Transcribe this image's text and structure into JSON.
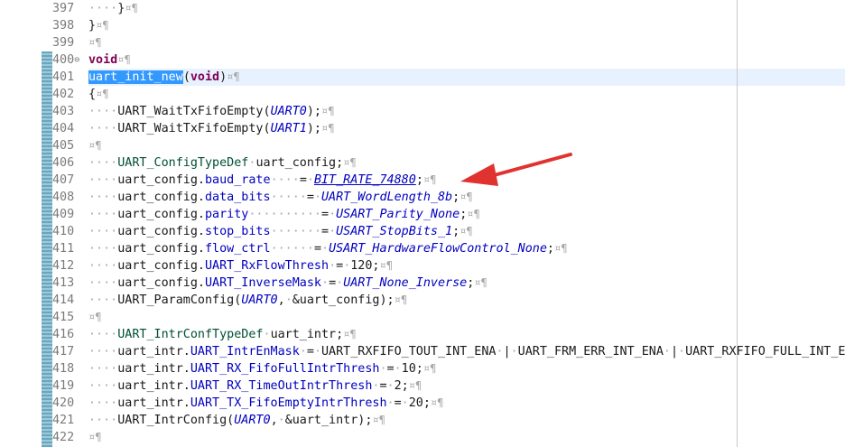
{
  "colors": {
    "keyword": "#7f0055",
    "type": "#005032",
    "constant": "#0000c0",
    "selection": "#3399ff",
    "current_line": "#e8f2fe",
    "annotation_arrow": "#e0332f"
  },
  "lines": [
    {
      "no": "397",
      "parts": [
        [
          "ws",
          "····"
        ],
        [
          "p",
          "}"
        ],
        [
          "pil",
          "¤¶"
        ]
      ]
    },
    {
      "no": "398",
      "parts": [
        [
          "p",
          "}"
        ],
        [
          "pil",
          "¤¶"
        ]
      ]
    },
    {
      "no": "399",
      "parts": [
        [
          "pil",
          "¤¶"
        ]
      ]
    },
    {
      "no": "400",
      "fold": true,
      "parts": [
        [
          "k",
          "void"
        ],
        [
          "pil",
          "¤¶"
        ]
      ]
    },
    {
      "no": "401",
      "current": true,
      "parts": [
        [
          "sel",
          "uart_init_new"
        ],
        [
          "p",
          "("
        ],
        [
          "k",
          "void"
        ],
        [
          "p",
          ")"
        ],
        [
          "pil",
          "¤¶"
        ]
      ]
    },
    {
      "no": "402",
      "parts": [
        [
          "p",
          "{"
        ],
        [
          "pil",
          "¤¶"
        ]
      ]
    },
    {
      "no": "403",
      "parts": [
        [
          "ws",
          "····"
        ],
        [
          "f",
          "UART_WaitTxFifoEmpty("
        ],
        [
          "c",
          "UART0"
        ],
        [
          "p",
          ");"
        ],
        [
          "pil",
          "¤¶"
        ]
      ]
    },
    {
      "no": "404",
      "parts": [
        [
          "ws",
          "····"
        ],
        [
          "f",
          "UART_WaitTxFifoEmpty("
        ],
        [
          "c",
          "UART1"
        ],
        [
          "p",
          ");"
        ],
        [
          "pil",
          "¤¶"
        ]
      ]
    },
    {
      "no": "405",
      "parts": [
        [
          "pil",
          "¤¶"
        ]
      ]
    },
    {
      "no": "406",
      "parts": [
        [
          "ws",
          "····"
        ],
        [
          "t",
          "UART_ConfigTypeDef"
        ],
        [
          "ws",
          "·"
        ],
        [
          "p",
          "uart_config;"
        ],
        [
          "pil",
          "¤¶"
        ]
      ]
    },
    {
      "no": "407",
      "parts": [
        [
          "ws",
          "····"
        ],
        [
          "p",
          "uart_config."
        ],
        [
          "m",
          "baud_rate"
        ],
        [
          "ws",
          "····"
        ],
        [
          "p",
          "="
        ],
        [
          "ws",
          "·"
        ],
        [
          "cu",
          "BIT_RATE_74880"
        ],
        [
          "p",
          ";"
        ],
        [
          "pil",
          "¤¶"
        ]
      ]
    },
    {
      "no": "408",
      "parts": [
        [
          "ws",
          "····"
        ],
        [
          "p",
          "uart_config."
        ],
        [
          "m",
          "data_bits"
        ],
        [
          "ws",
          "·····"
        ],
        [
          "p",
          "="
        ],
        [
          "ws",
          "·"
        ],
        [
          "c",
          "UART_WordLength_8b"
        ],
        [
          "p",
          ";"
        ],
        [
          "pil",
          "¤¶"
        ]
      ]
    },
    {
      "no": "409",
      "parts": [
        [
          "ws",
          "····"
        ],
        [
          "p",
          "uart_config."
        ],
        [
          "m",
          "parity"
        ],
        [
          "ws",
          "··········"
        ],
        [
          "p",
          "="
        ],
        [
          "ws",
          "·"
        ],
        [
          "c",
          "USART_Parity_None"
        ],
        [
          "p",
          ";"
        ],
        [
          "pil",
          "¤¶"
        ]
      ]
    },
    {
      "no": "410",
      "parts": [
        [
          "ws",
          "····"
        ],
        [
          "p",
          "uart_config."
        ],
        [
          "m",
          "stop_bits"
        ],
        [
          "ws",
          "·······"
        ],
        [
          "p",
          "="
        ],
        [
          "ws",
          "·"
        ],
        [
          "c",
          "USART_StopBits_1"
        ],
        [
          "p",
          ";"
        ],
        [
          "pil",
          "¤¶"
        ]
      ]
    },
    {
      "no": "411",
      "parts": [
        [
          "ws",
          "····"
        ],
        [
          "p",
          "uart_config."
        ],
        [
          "m",
          "flow_ctrl"
        ],
        [
          "ws",
          "······"
        ],
        [
          "p",
          "="
        ],
        [
          "ws",
          "·"
        ],
        [
          "c",
          "USART_HardwareFlowControl_None"
        ],
        [
          "p",
          ";"
        ],
        [
          "pil",
          "¤¶"
        ]
      ]
    },
    {
      "no": "412",
      "parts": [
        [
          "ws",
          "····"
        ],
        [
          "p",
          "uart_config."
        ],
        [
          "m",
          "UART_RxFlowThresh"
        ],
        [
          "ws",
          "·"
        ],
        [
          "p",
          "="
        ],
        [
          "ws",
          "·"
        ],
        [
          "p",
          "120;"
        ],
        [
          "pil",
          "¤¶"
        ]
      ]
    },
    {
      "no": "413",
      "parts": [
        [
          "ws",
          "····"
        ],
        [
          "p",
          "uart_config."
        ],
        [
          "m",
          "UART_InverseMask"
        ],
        [
          "ws",
          "·"
        ],
        [
          "p",
          "="
        ],
        [
          "ws",
          "·"
        ],
        [
          "c",
          "UART_None_Inverse"
        ],
        [
          "p",
          ";"
        ],
        [
          "pil",
          "¤¶"
        ]
      ]
    },
    {
      "no": "414",
      "parts": [
        [
          "ws",
          "····"
        ],
        [
          "f",
          "UART_ParamConfig("
        ],
        [
          "c",
          "UART0"
        ],
        [
          "p",
          ","
        ],
        [
          "ws",
          "·"
        ],
        [
          "p",
          "&uart_config);"
        ],
        [
          "pil",
          "¤¶"
        ]
      ]
    },
    {
      "no": "415",
      "parts": [
        [
          "pil",
          "¤¶"
        ]
      ]
    },
    {
      "no": "416",
      "parts": [
        [
          "ws",
          "····"
        ],
        [
          "t",
          "UART_IntrConfTypeDef"
        ],
        [
          "ws",
          "·"
        ],
        [
          "p",
          "uart_intr;"
        ],
        [
          "pil",
          "¤¶"
        ]
      ]
    },
    {
      "no": "417",
      "parts": [
        [
          "ws",
          "····"
        ],
        [
          "p",
          "uart_intr."
        ],
        [
          "m",
          "UART_IntrEnMask"
        ],
        [
          "ws",
          "·"
        ],
        [
          "p",
          "="
        ],
        [
          "ws",
          "·"
        ],
        [
          "p",
          "UART_RXFIFO_TOUT_INT_ENA"
        ],
        [
          "ws",
          "·"
        ],
        [
          "p",
          "|"
        ],
        [
          "ws",
          "·"
        ],
        [
          "p",
          "UART_FRM_ERR_INT_ENA"
        ],
        [
          "ws",
          "·"
        ],
        [
          "p",
          "|"
        ],
        [
          "ws",
          "·"
        ],
        [
          "p",
          "UART_RXFIFO_FULL_INT_ENA"
        ]
      ]
    },
    {
      "no": "418",
      "parts": [
        [
          "ws",
          "····"
        ],
        [
          "p",
          "uart_intr."
        ],
        [
          "m",
          "UART_RX_FifoFullIntrThresh"
        ],
        [
          "ws",
          "·"
        ],
        [
          "p",
          "="
        ],
        [
          "ws",
          "·"
        ],
        [
          "p",
          "10;"
        ],
        [
          "pil",
          "¤¶"
        ]
      ]
    },
    {
      "no": "419",
      "parts": [
        [
          "ws",
          "····"
        ],
        [
          "p",
          "uart_intr."
        ],
        [
          "m",
          "UART_RX_TimeOutIntrThresh"
        ],
        [
          "ws",
          "·"
        ],
        [
          "p",
          "="
        ],
        [
          "ws",
          "·"
        ],
        [
          "p",
          "2;"
        ],
        [
          "pil",
          "¤¶"
        ]
      ]
    },
    {
      "no": "420",
      "parts": [
        [
          "ws",
          "····"
        ],
        [
          "p",
          "uart_intr."
        ],
        [
          "m",
          "UART_TX_FifoEmptyIntrThresh"
        ],
        [
          "ws",
          "·"
        ],
        [
          "p",
          "="
        ],
        [
          "ws",
          "·"
        ],
        [
          "p",
          "20;"
        ],
        [
          "pil",
          "¤¶"
        ]
      ]
    },
    {
      "no": "421",
      "parts": [
        [
          "ws",
          "····"
        ],
        [
          "f",
          "UART_IntrConfig("
        ],
        [
          "c",
          "UART0"
        ],
        [
          "p",
          ","
        ],
        [
          "ws",
          "·"
        ],
        [
          "p",
          "&uart_intr);"
        ],
        [
          "pil",
          "¤¶"
        ]
      ]
    },
    {
      "no": "422",
      "parts": [
        [
          "pil",
          "¤¶"
        ]
      ]
    }
  ]
}
